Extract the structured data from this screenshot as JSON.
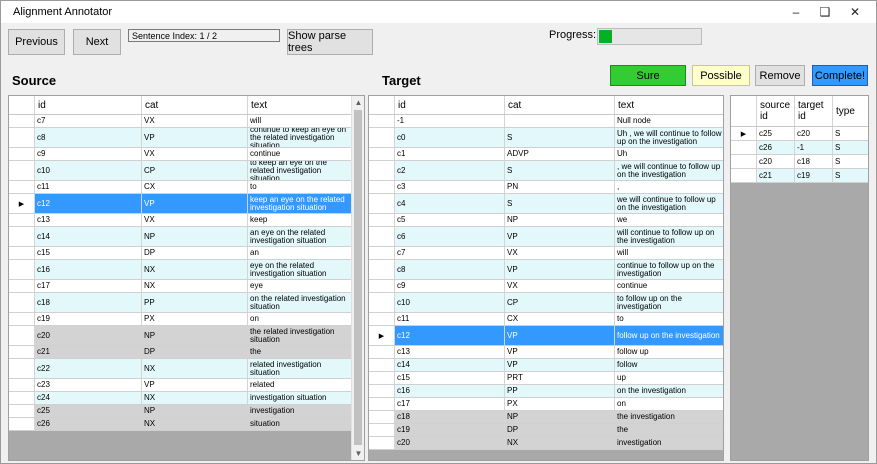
{
  "window": {
    "title": "Alignment Annotator"
  },
  "toolbar": {
    "previous_label": "Previous",
    "next_label": "Next",
    "sentence_index": "Sentence Index: 1 / 2",
    "show_parse_trees_label": "Show parse trees",
    "progress_label": "Progress:",
    "progress_fraction": 0.13
  },
  "sections": {
    "source": "Source",
    "target": "Target"
  },
  "annotation_buttons": {
    "sure": "Sure",
    "possible": "Possible",
    "remove": "Remove",
    "complete": "Complete!"
  },
  "colors": {
    "sure": "#33cc33",
    "possible": "#ffffcc",
    "complete": "#3399ff",
    "selected_row": "#3399ff",
    "alt_row": "#e2f8fb",
    "aligned_row": "#d3d3d3",
    "progress": "#06b025"
  },
  "source_table": {
    "columns": [
      "id",
      "cat",
      "text"
    ],
    "rows": [
      {
        "id": "c7",
        "cat": "VX",
        "text": "will",
        "style": "plain"
      },
      {
        "id": "c8",
        "cat": "VP",
        "text": "continue to keep an eye on the related investigation situation",
        "style": "alt"
      },
      {
        "id": "c9",
        "cat": "VX",
        "text": "continue",
        "style": "plain"
      },
      {
        "id": "c10",
        "cat": "CP",
        "text": "to keep an eye on the related investigation situation",
        "style": "alt"
      },
      {
        "id": "c11",
        "cat": "CX",
        "text": "to",
        "style": "plain"
      },
      {
        "id": "c12",
        "cat": "VP",
        "text": "keep an eye on the related investigation situation",
        "style": "selected"
      },
      {
        "id": "c13",
        "cat": "VX",
        "text": "keep",
        "style": "plain"
      },
      {
        "id": "c14",
        "cat": "NP",
        "text": "an eye on the related investigation situation",
        "style": "alt"
      },
      {
        "id": "c15",
        "cat": "DP",
        "text": "an",
        "style": "plain"
      },
      {
        "id": "c16",
        "cat": "NX",
        "text": "eye on the related investigation situation",
        "style": "alt"
      },
      {
        "id": "c17",
        "cat": "NX",
        "text": "eye",
        "style": "plain"
      },
      {
        "id": "c18",
        "cat": "PP",
        "text": "on the related investigation situation",
        "style": "alt"
      },
      {
        "id": "c19",
        "cat": "PX",
        "text": "on",
        "style": "plain"
      },
      {
        "id": "c20",
        "cat": "NP",
        "text": "the related investigation situation",
        "style": "gray"
      },
      {
        "id": "c21",
        "cat": "DP",
        "text": "the",
        "style": "gray"
      },
      {
        "id": "c22",
        "cat": "NX",
        "text": "related investigation situation",
        "style": "alt"
      },
      {
        "id": "c23",
        "cat": "VP",
        "text": "related",
        "style": "plain"
      },
      {
        "id": "c24",
        "cat": "NX",
        "text": "investigation situation",
        "style": "alt"
      },
      {
        "id": "c25",
        "cat": "NP",
        "text": "investigation",
        "style": "gray"
      },
      {
        "id": "c26",
        "cat": "NX",
        "text": "situation",
        "style": "gray"
      }
    ]
  },
  "target_table": {
    "columns": [
      "id",
      "cat",
      "text"
    ],
    "rows": [
      {
        "id": "-1",
        "cat": "",
        "text": "Null node",
        "style": "plain"
      },
      {
        "id": "c0",
        "cat": "S",
        "text": "Uh , we will continue to follow up on the investigation",
        "style": "alt"
      },
      {
        "id": "c1",
        "cat": "ADVP",
        "text": "Uh",
        "style": "plain"
      },
      {
        "id": "c2",
        "cat": "S",
        "text": ", we will continue to follow up on the investigation",
        "style": "alt"
      },
      {
        "id": "c3",
        "cat": "PN",
        "text": ",",
        "style": "plain"
      },
      {
        "id": "c4",
        "cat": "S",
        "text": "we will continue to follow up on the investigation",
        "style": "alt"
      },
      {
        "id": "c5",
        "cat": "NP",
        "text": "we",
        "style": "plain"
      },
      {
        "id": "c6",
        "cat": "VP",
        "text": "will continue to follow up on the investigation",
        "style": "alt"
      },
      {
        "id": "c7",
        "cat": "VX",
        "text": "will",
        "style": "plain"
      },
      {
        "id": "c8",
        "cat": "VP",
        "text": "continue to follow up on the investigation",
        "style": "alt"
      },
      {
        "id": "c9",
        "cat": "VX",
        "text": "continue",
        "style": "plain"
      },
      {
        "id": "c10",
        "cat": "CP",
        "text": "to follow up on the investigation",
        "style": "alt"
      },
      {
        "id": "c11",
        "cat": "CX",
        "text": "to",
        "style": "plain"
      },
      {
        "id": "c12",
        "cat": "VP",
        "text": "follow up on the investigation",
        "style": "selected"
      },
      {
        "id": "c13",
        "cat": "VP",
        "text": "follow up",
        "style": "plain"
      },
      {
        "id": "c14",
        "cat": "VP",
        "text": "follow",
        "style": "alt"
      },
      {
        "id": "c15",
        "cat": "PRT",
        "text": "up",
        "style": "plain"
      },
      {
        "id": "c16",
        "cat": "PP",
        "text": "on the investigation",
        "style": "alt"
      },
      {
        "id": "c17",
        "cat": "PX",
        "text": "on",
        "style": "plain"
      },
      {
        "id": "c18",
        "cat": "NP",
        "text": "the investigation",
        "style": "gray"
      },
      {
        "id": "c19",
        "cat": "DP",
        "text": "the",
        "style": "gray"
      },
      {
        "id": "c20",
        "cat": "NX",
        "text": "investigation",
        "style": "gray"
      }
    ]
  },
  "alignment_table": {
    "columns": [
      "source id",
      "target id",
      "type"
    ],
    "rows": [
      {
        "source": "c25",
        "target": "c20",
        "type": "S"
      },
      {
        "source": "c26",
        "target": "-1",
        "type": "S"
      },
      {
        "source": "c20",
        "target": "c18",
        "type": "S"
      },
      {
        "source": "c21",
        "target": "c19",
        "type": "S"
      }
    ]
  }
}
